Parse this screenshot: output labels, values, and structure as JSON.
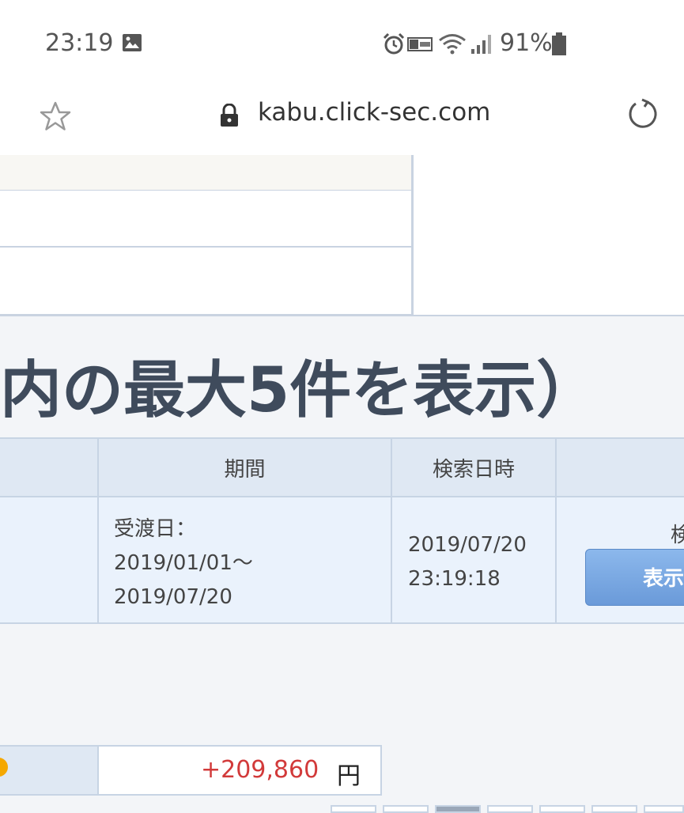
{
  "status_bar": {
    "time": "23:19",
    "battery_percent": "91%"
  },
  "browser": {
    "url": "kabu.click-sec.com"
  },
  "section": {
    "heading_fragment": "内の最大5件を表示）"
  },
  "history_table": {
    "headers": [
      "",
      "期間",
      "検索日時",
      ""
    ],
    "row": {
      "period_label": "受渡日：",
      "period_from": "2019/01/01〜",
      "period_to": "2019/07/20",
      "search_date": "2019/07/20",
      "search_time": "23:19:18",
      "action_label": "検",
      "show_button": "表示"
    }
  },
  "profit": {
    "amount": "+209,860",
    "unit": "円",
    "amount_color": "#d23a3a"
  },
  "colors": {
    "header_bg": "#dfe8f3",
    "cell_bg": "#eaf2fc",
    "border": "#c7d4e4",
    "button": "#6a9ad9"
  }
}
